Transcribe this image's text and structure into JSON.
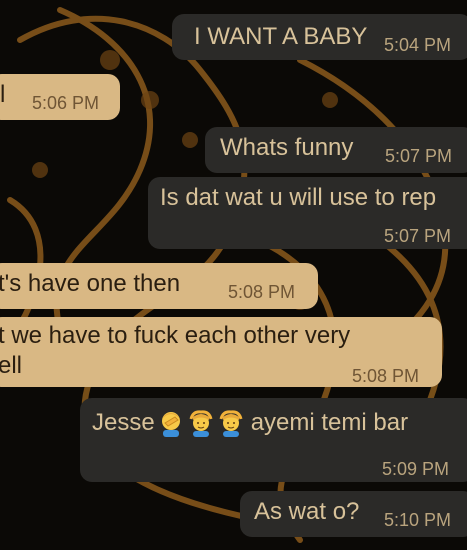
{
  "theme": {
    "outgoing_bg": "#2b2a28",
    "outgoing_text": "#d8c29a",
    "incoming_bg": "#d9b884",
    "incoming_text": "#2a1e10",
    "wallpaper": "gold-dragon-on-black"
  },
  "messages": [
    {
      "direction": "outgoing",
      "text": "I WANT A BABY",
      "time": "5:04 PM"
    },
    {
      "direction": "incoming",
      "text": "l",
      "time": "5:06 PM"
    },
    {
      "direction": "outgoing",
      "text": "Whats funny",
      "time": "5:07 PM"
    },
    {
      "direction": "outgoing",
      "text": "Is dat wat u will use to rep",
      "time": "5:07 PM"
    },
    {
      "direction": "incoming",
      "text": "t's have one then",
      "time": "5:08 PM"
    },
    {
      "direction": "incoming",
      "text": "t we have to fuck each other very\nell",
      "time": "5:08 PM"
    },
    {
      "direction": "outgoing",
      "text_before": "Jesse",
      "emojis": [
        "person-facepalming-emoji",
        "person-gesturing-ok-emoji",
        "person-gesturing-ok-emoji"
      ],
      "text_after": "ayemi temi bar",
      "time": "5:09 PM"
    },
    {
      "direction": "outgoing",
      "text": "As wat o?",
      "time": "5:10 PM"
    }
  ]
}
